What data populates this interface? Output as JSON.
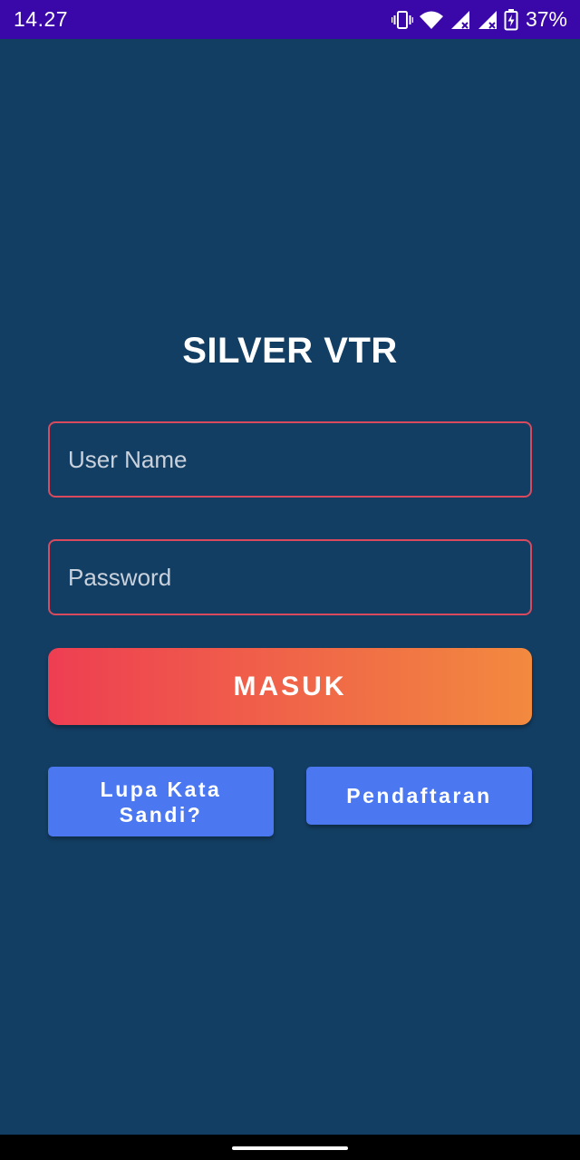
{
  "status_bar": {
    "time": "14.27",
    "battery_text": "37%",
    "icons": [
      "vibrate-icon",
      "wifi-icon",
      "signal-icon",
      "signal-icon",
      "battery-charging-icon"
    ]
  },
  "app": {
    "title": "SILVER VTR"
  },
  "form": {
    "username_placeholder": "User Name",
    "password_placeholder": "Password",
    "login_label": "MASUK",
    "forgot_label": "Lupa Kata Sandi?",
    "register_label": "Pendaftaran"
  },
  "colors": {
    "background": "#133e63",
    "status_bar": "#3a08a8",
    "field_border": "#d94a5e",
    "login_gradient_start": "#ee3e52",
    "login_gradient_end": "#f28a3f",
    "secondary_button": "#4b78f0"
  }
}
